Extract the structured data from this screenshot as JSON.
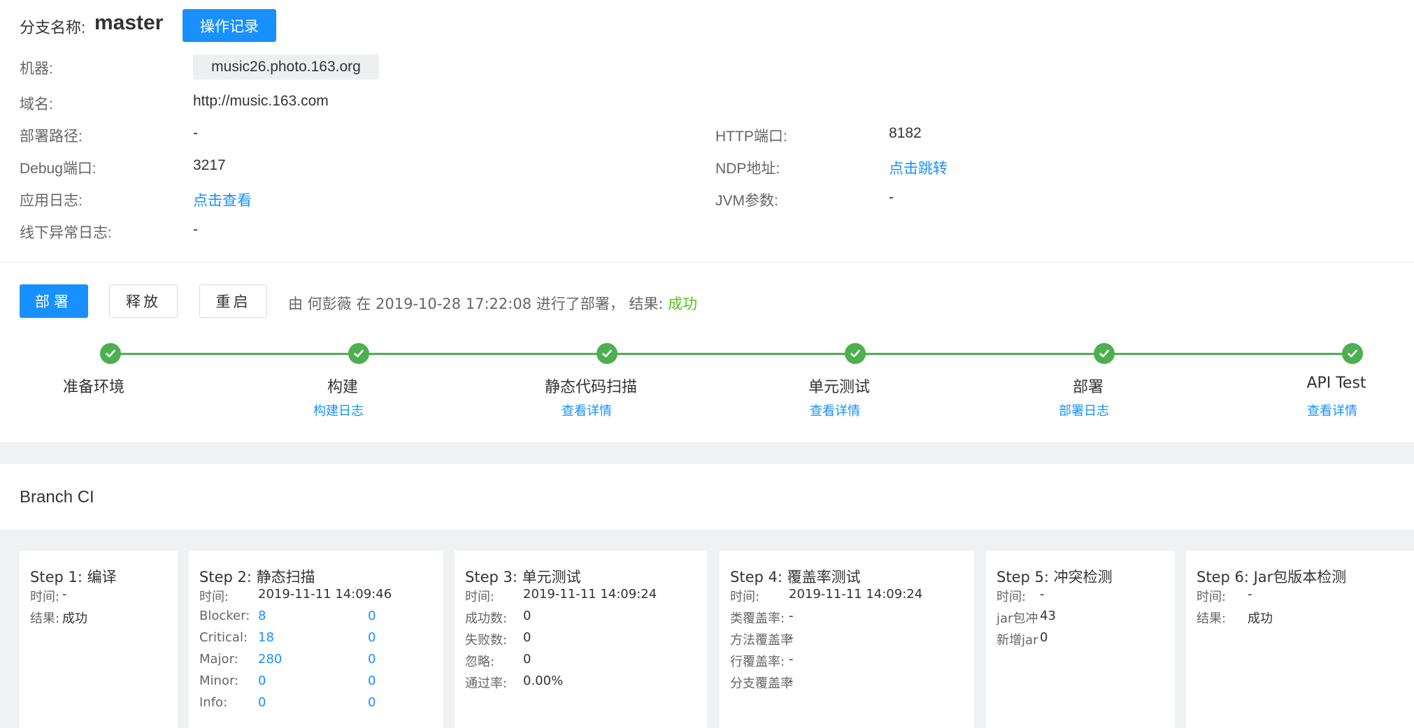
{
  "header": {
    "branch_label": "分支名称:",
    "branch_name": "master",
    "history_button": "操作记录"
  },
  "info": {
    "machine_label": "机器:",
    "machine_value": "music26.photo.163.org",
    "domain_label": "域名:",
    "domain_value": "http://music.163.com",
    "deploy_path_label": "部署路径:",
    "deploy_path_value": "-",
    "http_port_label": "HTTP端口:",
    "http_port_value": "8182",
    "debug_port_label": "Debug端口:",
    "debug_port_value": "3217",
    "ndp_label": "NDP地址:",
    "ndp_link": "点击跳转",
    "app_log_label": "应用日志:",
    "app_log_link": "点击查看",
    "jvm_label": "JVM参数:",
    "jvm_value": "-",
    "offline_log_label": "线下异常日志:",
    "offline_log_value": "-"
  },
  "actions": {
    "deploy": "部署",
    "release": "释放",
    "restart": "重启",
    "status_text": "由 何彭薇 在 2019-10-28 17:22:08 进行了部署， 结果:",
    "status_result": "成功",
    "status_color": "#52c41a"
  },
  "pipeline": [
    {
      "title": "准备环境",
      "link": ""
    },
    {
      "title": "构建",
      "link": "构建日志"
    },
    {
      "title": "静态代码扫描",
      "link": "查看详情"
    },
    {
      "title": "单元测试",
      "link": "查看详情"
    },
    {
      "title": "部署",
      "link": "部署日志"
    },
    {
      "title": "API Test",
      "link": "查看详情"
    }
  ],
  "ci": {
    "title": "Branch CI",
    "step1": {
      "title": "Step 1: 编译",
      "time_label": "时间:",
      "time": "-",
      "result_label": "结果:",
      "result": "成功"
    },
    "step2": {
      "title": "Step 2: 静态扫描",
      "time_label": "时间:",
      "time": "2019-11-11 14:09:46",
      "rows": [
        {
          "k": "Blocker:",
          "a": "8",
          "b": "0"
        },
        {
          "k": "Critical:",
          "a": "18",
          "b": "0"
        },
        {
          "k": "Major:",
          "a": "280",
          "b": "0"
        },
        {
          "k": "Minor:",
          "a": "0",
          "b": "0"
        },
        {
          "k": "Info:",
          "a": "0",
          "b": "0"
        }
      ]
    },
    "step3": {
      "title": "Step 3: 单元测试",
      "time_label": "时间:",
      "time": "2019-11-11 14:09:24",
      "success_label": "成功数:",
      "success": "0",
      "fail_label": "失败数:",
      "fail": "0",
      "ignore_label": "忽略:",
      "ignore": "0",
      "pass_label": "通过率:",
      "pass": "0.00%"
    },
    "step4": {
      "title": "Step 4: 覆盖率测试",
      "time_label": "时间:",
      "time": "2019-11-11 14:09:24",
      "class_label": "类覆盖率:",
      "class": "-",
      "method_label": "方法覆盖率",
      "method": "-",
      "line_label": "行覆盖率:",
      "line": "-",
      "branch_label": "分支覆盖率",
      "branch": "-"
    },
    "step5": {
      "title": "Step 5: 冲突检测",
      "time_label": "时间:",
      "time": "-",
      "jar_conflict_label": "jar包冲",
      "jar_conflict": "43",
      "new_jar_label": "新增jar",
      "new_jar": "0"
    },
    "step6": {
      "title": "Step 6: Jar包版本检测",
      "time_label": "时间:",
      "time": "-",
      "result_label": "结果:",
      "result": "成功"
    }
  }
}
